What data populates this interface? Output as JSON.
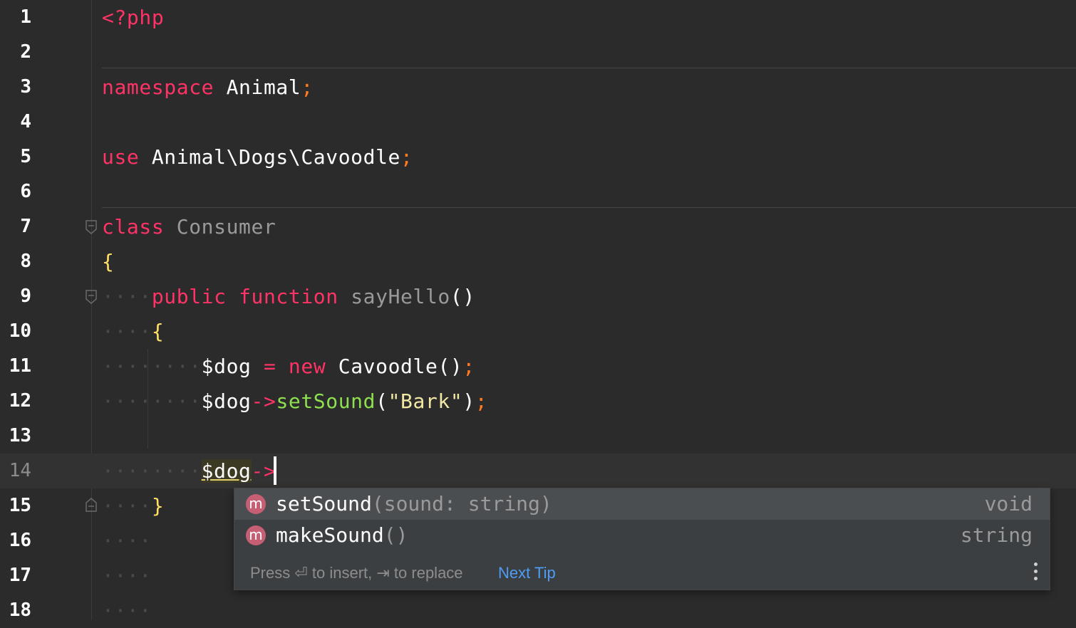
{
  "lines": [
    {
      "n": "1"
    },
    {
      "n": "2"
    },
    {
      "n": "3"
    },
    {
      "n": "4"
    },
    {
      "n": "5"
    },
    {
      "n": "6"
    },
    {
      "n": "7"
    },
    {
      "n": "8"
    },
    {
      "n": "9"
    },
    {
      "n": "10"
    },
    {
      "n": "11"
    },
    {
      "n": "12"
    },
    {
      "n": "13"
    },
    {
      "n": "14"
    },
    {
      "n": "15"
    },
    {
      "n": "16"
    },
    {
      "n": "17"
    },
    {
      "n": "18"
    }
  ],
  "code": {
    "php_open": "<?php",
    "namespace_kw": "namespace",
    "namespace_name": "Animal",
    "semicolon": ";",
    "use_kw": "use",
    "use_path": "Animal\\Dogs\\Cavoodle",
    "class_kw": "class",
    "class_name": "Consumer",
    "open_brace": "{",
    "close_brace": "}",
    "public_kw": "public",
    "function_kw": "function",
    "func_name": "sayHello",
    "parens": "()",
    "var_dog": "$dog",
    "assign": "=",
    "new_kw": "new",
    "ctor": "Cavoodle",
    "arrow": "->",
    "set_sound": "setSound",
    "open_paren": "(",
    "close_paren": ")",
    "bark_str": "\"Bark\""
  },
  "completion": {
    "items": [
      {
        "icon": "m",
        "name": "setSound",
        "signature": "(sound: string)",
        "type": "void"
      },
      {
        "icon": "m",
        "name": "makeSound",
        "signature": "()",
        "type": "string"
      }
    ],
    "footer_text": "Press ⏎ to insert, ⇥ to replace",
    "next_tip": "Next Tip"
  },
  "colors": {
    "background": "#2b2b2b",
    "keyword": "#ff3366",
    "method": "#8de04f",
    "string": "#f2e8a6",
    "link": "#4e9cf5"
  }
}
